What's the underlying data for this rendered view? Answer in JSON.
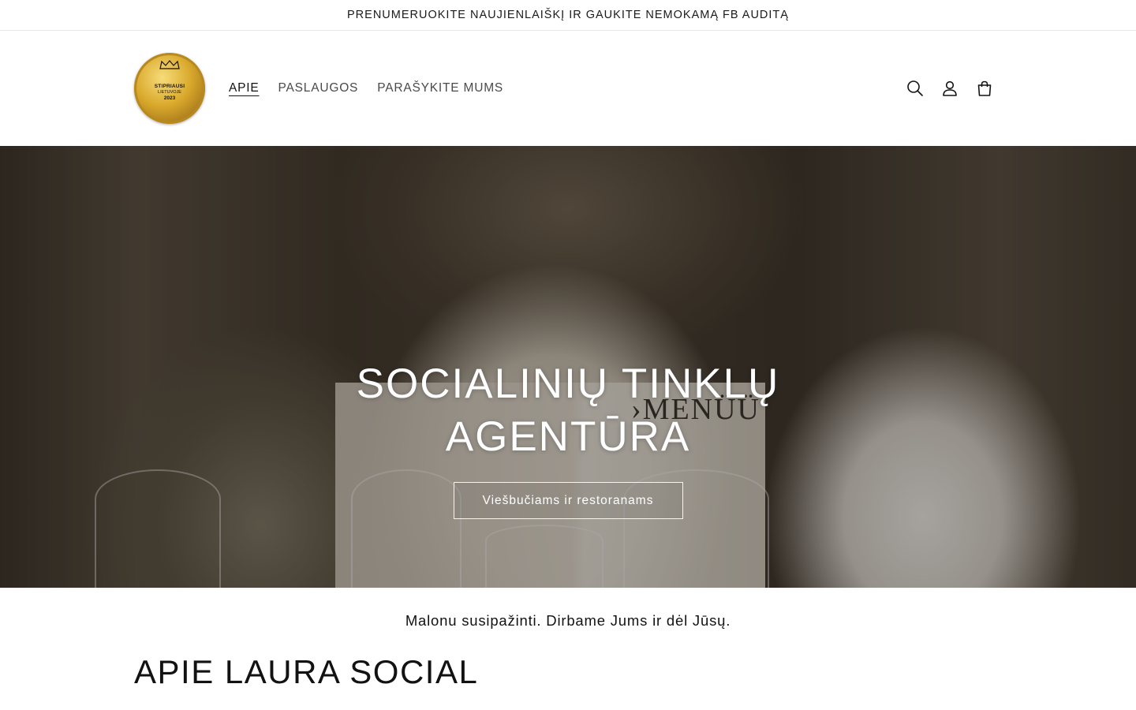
{
  "announcement": {
    "text": "PRENUMERUOKITE NAUJIENLAIŠKĮ IR GAUKITE NEMOKAMĄ FB AUDITĄ"
  },
  "logo": {
    "line1": "STIPRIAUSI",
    "line2": "LIETUVOJE",
    "line3": "2023",
    "colors": {
      "gold": "#d9a92c",
      "dark": "#1b1305"
    }
  },
  "nav": {
    "items": [
      {
        "label": "APIE",
        "active": true
      },
      {
        "label": "PASLAUGOS",
        "active": false
      },
      {
        "label": "PARAŠYKITE MUMS",
        "active": false
      }
    ]
  },
  "header_icons": [
    "search-icon",
    "account-icon",
    "cart-icon"
  ],
  "hero": {
    "title_line1": "SOCIALINIŲ TINKLŲ",
    "title_line2": "AGENTŪRA",
    "button_label": "Viešbučiams ir restoranams",
    "menu_text": "›MENÜÜ"
  },
  "tagline": "Malonu susipažinti. Dirbame Jums ir dėl Jūsų.",
  "about": {
    "title": "APIE LAURA SOCIAL"
  }
}
